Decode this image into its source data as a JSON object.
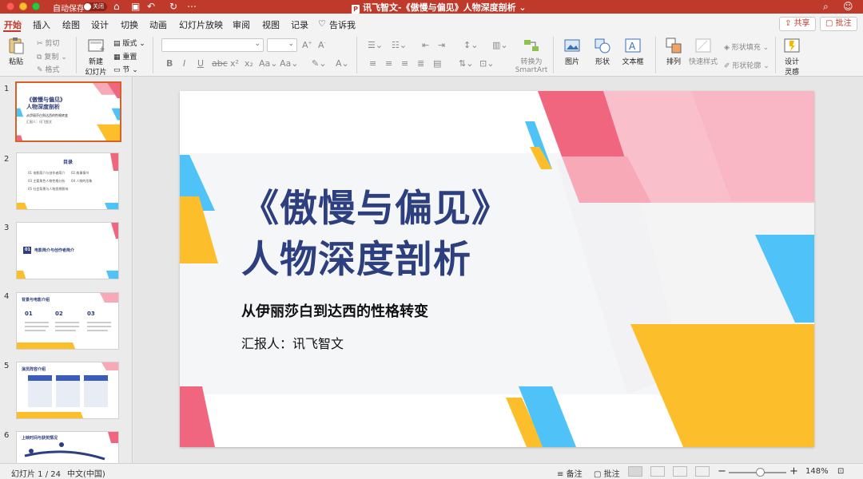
{
  "window": {
    "autosave_label": "自动保存",
    "autosave_state": "关闭",
    "title": "讯飞智文-《傲慢与偏见》人物深度剖析",
    "ppt_badge": "P"
  },
  "tabs": [
    "开始",
    "插入",
    "绘图",
    "设计",
    "切换",
    "动画",
    "幻灯片放映",
    "审阅",
    "视图",
    "记录",
    "告诉我"
  ],
  "actions": {
    "share": "共享",
    "comment": "批注"
  },
  "ribbon": {
    "paste": "粘贴",
    "cut": "剪切",
    "copy": "复制",
    "format": "格式",
    "new_slide_l1": "新建",
    "new_slide_l2": "幻灯片",
    "layout": "版式",
    "reset": "重置",
    "section": "节",
    "smartart_l1": "转换为",
    "smartart_l2": "SmartArt",
    "picture": "图片",
    "shape": "形状",
    "textbox": "文本框",
    "arrange": "排列",
    "quick_styles": "快速样式",
    "shape_fill": "形状填充",
    "shape_outline": "形状轮廓",
    "design_l1": "设计",
    "design_l2": "灵感"
  },
  "thumbnails": [
    {
      "num": "1",
      "title_l1": "《傲慢与偏见》",
      "title_l2": "人物深度剖析",
      "sub": "从伊丽莎白到达西的性格转变",
      "rep": "汇报人：讯飞智文"
    },
    {
      "num": "2",
      "title": "目录",
      "items": [
        "01  电影简介与创作者简介",
        "02  故事情节",
        "03  主要角色人物性格分析",
        "04  人物的形象",
        "05  社会背景与人物思想影响"
      ]
    },
    {
      "num": "3",
      "badge": "01",
      "title": "电影简介与创作者简介"
    },
    {
      "num": "4",
      "title": "背景与电影介绍",
      "cols": [
        "01",
        "02",
        "03"
      ]
    },
    {
      "num": "5",
      "title": "演员阵容介绍"
    },
    {
      "num": "6",
      "title": "上映时间与获奖情况"
    }
  ],
  "slide": {
    "title_l1": "《傲慢与偏见》",
    "title_l2": "人物深度剖析",
    "subtitle": "从伊丽莎白到达西的性格转变",
    "reporter": "汇报人：讯飞智文"
  },
  "status": {
    "slide_counter": "幻灯片 1 / 24",
    "language": "中文(中国)",
    "notes": "备注",
    "comments": "批注",
    "zoom": "148%"
  },
  "colors": {
    "accent": "#c03a2b",
    "title_blue": "#2d3f7e",
    "pink": "#f7a9b8",
    "pink_dark": "#f1667f",
    "yellow": "#fcbf2b",
    "sky": "#4fc3f7"
  }
}
